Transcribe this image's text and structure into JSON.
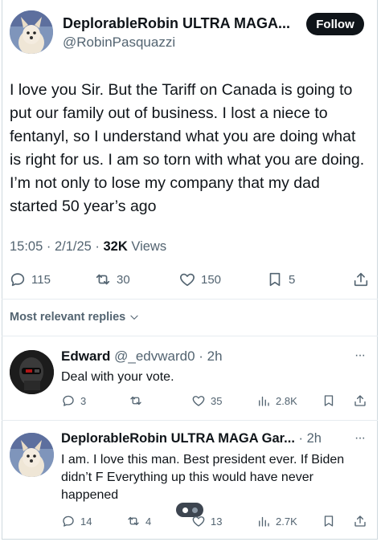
{
  "main_tweet": {
    "author_name": "DeplorableRobin ULTRA MAGA...",
    "author_handle": "@RobinPasquazzi",
    "follow_label": "Follow",
    "text": "I love you Sir. But the Tariff on Canada is going to put our family out of business.  I lost a niece to fentanyl, so I understand what you are doing what is right for us. I am so torn with what you are doing. I’m not only to lose my company that my dad started 50 year’s ago",
    "time": "15:05 · 2/1/25 · ",
    "views_count": "32K",
    "views_label": " Views",
    "replies": "115",
    "retweets": "30",
    "likes": "150",
    "bookmarks": "5"
  },
  "replies_sort": {
    "label": "Most relevant replies"
  },
  "replies": [
    {
      "name": "Edward",
      "meta": "@_edvward0 · 2h",
      "text": "Deal with your vote.",
      "replies": "3",
      "retweets": "",
      "likes": "35",
      "views": "2.8K"
    },
    {
      "name": "DeplorableRobin ULTRA MAGA Gar...",
      "meta": "· 2h",
      "text": "I am. I love this man. Best president ever. If Biden didn’t F Everything up this would have never happened",
      "replies": "14",
      "retweets": "4",
      "likes": "13",
      "views": "2.7K"
    }
  ],
  "more_glyph": "···",
  "icons": [
    "reply-icon",
    "retweet-icon",
    "like-icon",
    "bookmark-icon",
    "share-icon",
    "views-icon",
    "chevron-down-icon",
    "more-icon"
  ]
}
